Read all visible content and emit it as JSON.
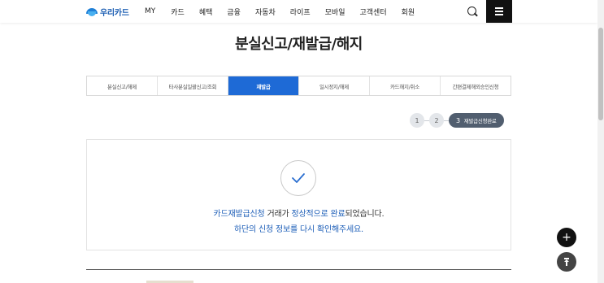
{
  "header": {
    "logo_text": "우리카드",
    "nav": [
      "MY",
      "카드",
      "혜택",
      "금융",
      "자동차",
      "라이프",
      "모바일",
      "고객센터",
      "회원"
    ],
    "search_icon": "search-icon",
    "menu_icon": "hamburger-menu-icon"
  },
  "page": {
    "title": "분실신고/재발급/해지"
  },
  "tabs": [
    {
      "label": "분실신고/해제",
      "active": false
    },
    {
      "label": "타사분실일괄신고/조회",
      "active": false
    },
    {
      "label": "재발급",
      "active": true
    },
    {
      "label": "일시정지/해제",
      "active": false
    },
    {
      "label": "카드해지/취소",
      "active": false
    },
    {
      "label": "간편결제해외승인신청",
      "active": false
    }
  ],
  "steps": {
    "step1": "1",
    "step2": "2",
    "step3_num": "3",
    "step3_label": "재발급신청완료"
  },
  "result": {
    "line1_part1": "카드재발급신청",
    "line1_part2": " 거래가 ",
    "line1_part3": "정상적으로 완료",
    "line1_part4": "되었습니다.",
    "line2": "하단의 신청 정보를 다시 확인해주세요."
  },
  "floating": {
    "plus": "+",
    "top_icon": "arrow-up-icon"
  },
  "colors": {
    "accent": "#1e6ad6",
    "link": "#1e5fb8",
    "step_active": "#515e6f"
  }
}
